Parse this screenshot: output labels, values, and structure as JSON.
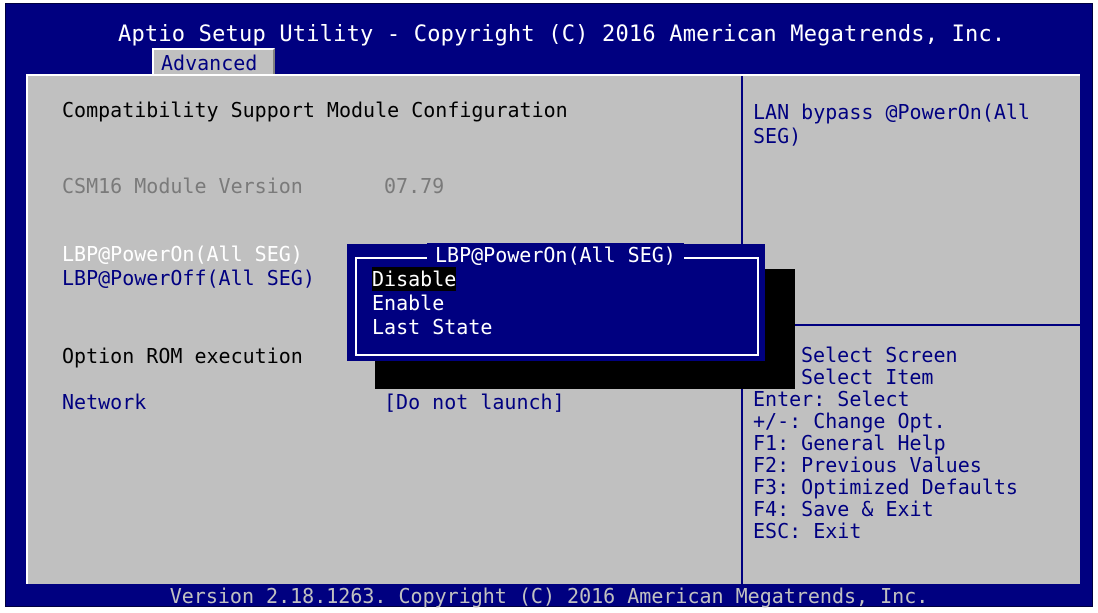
{
  "header": {
    "title": "Aptio Setup Utility - Copyright (C) 2016 American Megatrends, Inc.",
    "active_tab": "Advanced"
  },
  "main": {
    "heading": "Compatibility Support Module Configuration",
    "csm_label": "CSM16 Module Version",
    "csm_value": "07.79",
    "lbp_power_on_label": "LBP@PowerOn(All SEG)",
    "lbp_power_off_label": "LBP@PowerOff(All SEG)",
    "option_rom_label": "Option ROM execution",
    "network_label": "Network",
    "network_value": "[Do not launch]"
  },
  "popup": {
    "title": "LBP@PowerOn(All SEG)",
    "options": [
      "Disable",
      "Enable",
      "Last State"
    ],
    "selected": "Disable"
  },
  "help": {
    "description": "LAN bypass @PowerOn(All SEG)"
  },
  "hotkeys": {
    "select_screen": "Select Screen",
    "select_item": "Select Item",
    "enter": "Enter: Select",
    "change": "+/-: Change Opt.",
    "f1": "F1: General Help",
    "f2": "F2: Previous Values",
    "f3": "F3: Optimized Defaults",
    "f4": "F4: Save & Exit",
    "esc": "ESC: Exit"
  },
  "footer": {
    "text": "Version 2.18.1263. Copyright (C) 2016 American Megatrends, Inc."
  },
  "colors": {
    "bios_blue": "#000080",
    "panel_grey": "#c0c0c0",
    "highlight_white": "#ffffff",
    "disabled_grey": "#7a7a7a"
  }
}
